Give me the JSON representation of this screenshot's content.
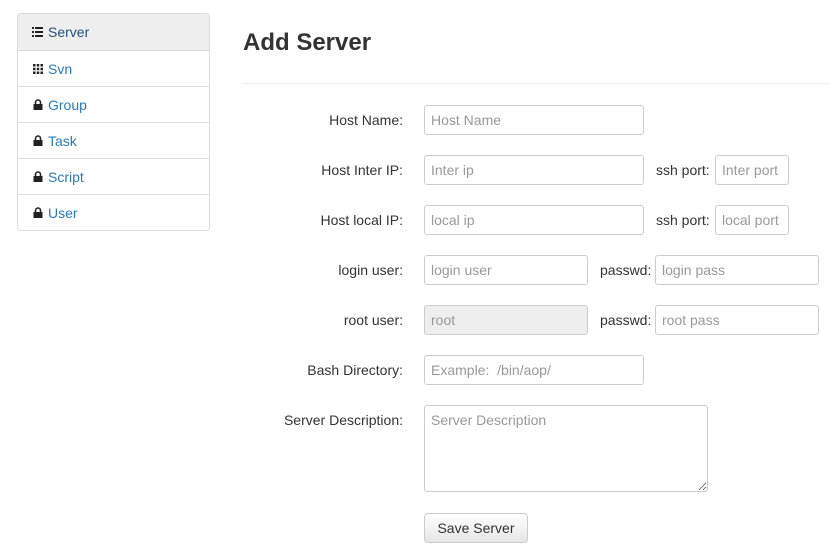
{
  "sidebar": {
    "items": [
      {
        "label": "Server",
        "icon": "list-icon",
        "active": true
      },
      {
        "label": "Svn",
        "icon": "grid-icon"
      },
      {
        "label": "Group",
        "icon": "lock-icon"
      },
      {
        "label": "Task",
        "icon": "lock-icon"
      },
      {
        "label": "Script",
        "icon": "lock-icon"
      },
      {
        "label": "User",
        "icon": "lock-icon"
      }
    ]
  },
  "page": {
    "title": "Add Server"
  },
  "form": {
    "host_name": {
      "label": "Host Name:",
      "placeholder": "Host Name",
      "value": ""
    },
    "host_inter_ip": {
      "label": "Host Inter IP:",
      "placeholder": "Inter ip",
      "value": ""
    },
    "inter_ssh_port": {
      "label": "ssh port:",
      "placeholder": "Inter port",
      "value": ""
    },
    "host_local_ip": {
      "label": "Host local IP:",
      "placeholder": "local ip",
      "value": ""
    },
    "local_ssh_port": {
      "label": "ssh port:",
      "placeholder": "local port",
      "value": ""
    },
    "login_user": {
      "label": "login user:",
      "placeholder": "login user",
      "value": ""
    },
    "login_passwd": {
      "label": "passwd:",
      "placeholder": "login pass",
      "value": ""
    },
    "root_user": {
      "label": "root user:",
      "placeholder": "root",
      "value": ""
    },
    "root_passwd": {
      "label": "passwd:",
      "placeholder": "root pass",
      "value": ""
    },
    "bash_directory": {
      "label": "Bash Directory:",
      "placeholder": "Example:  /bin/aop/",
      "value": ""
    },
    "server_description": {
      "label": "Server Description:",
      "placeholder": "Server Description",
      "value": ""
    },
    "submit_label": "Save Server"
  },
  "colors": {
    "link": "#2a7ab8",
    "active_bg": "#eeeeee",
    "border": "#dddddd"
  }
}
